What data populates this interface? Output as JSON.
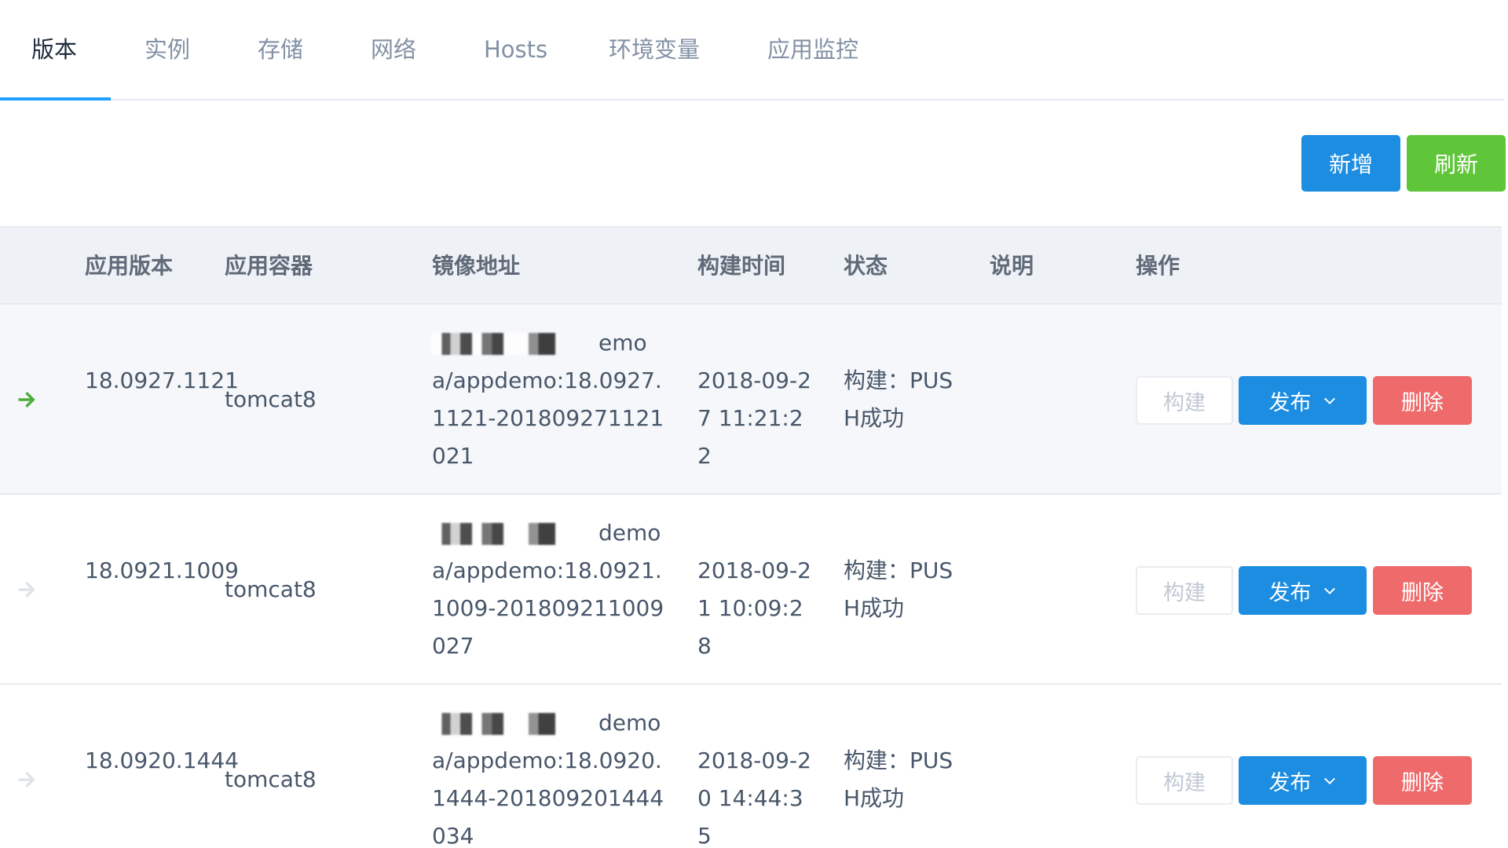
{
  "tabs": [
    {
      "label": "版本",
      "active": true
    },
    {
      "label": "实例"
    },
    {
      "label": "存储"
    },
    {
      "label": "网络"
    },
    {
      "label": "Hosts"
    },
    {
      "label": "环境变量"
    },
    {
      "label": "应用监控"
    }
  ],
  "toolbar": {
    "add_label": "新增",
    "refresh_label": "刷新"
  },
  "table": {
    "columns": [
      "应用版本",
      "应用容器",
      "镜像地址",
      "构建时间",
      "状态",
      "说明",
      "操作"
    ],
    "rows": [
      {
        "current": true,
        "version": "18.0927.1121",
        "container": "tomcat8",
        "image_prefix_visible": "emo",
        "image": "a/appdemo:18.0927.1121-201809271121021",
        "build_time": "2018-09-27 11:21:22",
        "status": "构建：PUSH成功",
        "note": ""
      },
      {
        "current": false,
        "version": "18.0921.1009",
        "container": "tomcat8",
        "image_prefix_visible": "demo",
        "image": "a/appdemo:18.0921.1009-201809211009027",
        "build_time": "2018-09-21 10:09:28",
        "status": "构建：PUSH成功",
        "note": ""
      },
      {
        "current": false,
        "version": "18.0920.1444",
        "container": "tomcat8",
        "image_prefix_visible": "demo",
        "image": "a/appdemo:18.0920.1444-201809201444034",
        "build_time": "2018-09-20 14:44:35",
        "status": "构建：PUSH成功",
        "note": ""
      }
    ],
    "actions": {
      "build_label": "构建",
      "publish_label": "发布",
      "delete_label": "删除"
    }
  },
  "colors": {
    "accent": "#20a0ff",
    "primary_button": "#1c8de0",
    "success_button": "#5fc63a",
    "danger_button": "#ef6b6b",
    "current_arrow": "#4caf3a",
    "inactive_arrow": "#dfe3e8"
  }
}
